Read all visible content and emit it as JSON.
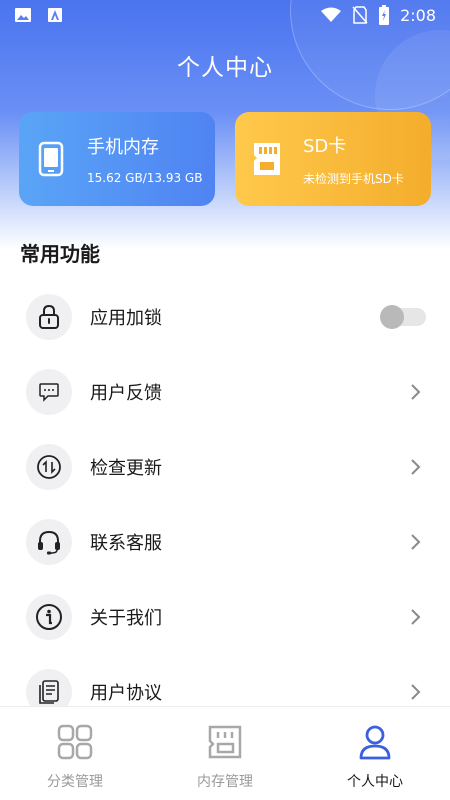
{
  "status_bar": {
    "time": "2:08",
    "left_icons": [
      "image-icon",
      "app-notification-icon"
    ],
    "right_icons": [
      "wifi-icon",
      "no-sim-icon",
      "battery-charging-icon"
    ]
  },
  "header": {
    "title": "个人中心"
  },
  "storage_cards": {
    "internal": {
      "title": "手机内存",
      "usage": "15.62 GB/13.93 GB",
      "icon": "phone-icon"
    },
    "sd": {
      "title": "SD卡",
      "status": "未检测到手机SD卡",
      "icon": "sd-card-icon"
    }
  },
  "section": {
    "title": "常用功能"
  },
  "menu": {
    "items": [
      {
        "label": "应用加锁",
        "icon": "lock-icon",
        "control": "toggle",
        "toggle_on": false
      },
      {
        "label": "用户反馈",
        "icon": "feedback-icon",
        "control": "chevron"
      },
      {
        "label": "检查更新",
        "icon": "update-icon",
        "control": "chevron"
      },
      {
        "label": "联系客服",
        "icon": "headset-icon",
        "control": "chevron"
      },
      {
        "label": "关于我们",
        "icon": "info-icon",
        "control": "chevron"
      },
      {
        "label": "用户协议",
        "icon": "document-icon",
        "control": "chevron"
      }
    ]
  },
  "tabbar": {
    "tabs": [
      {
        "label": "分类管理",
        "icon": "grid-icon",
        "active": false
      },
      {
        "label": "内存管理",
        "icon": "memory-icon",
        "active": false
      },
      {
        "label": "个人中心",
        "icon": "user-icon",
        "active": true
      }
    ]
  },
  "colors": {
    "accent": "#4a73ef",
    "card_blue": "#4f83f2",
    "card_orange": "#f4ad2c",
    "tab_active": "#3a5fe0",
    "tab_inactive": "#9a9a9a"
  }
}
